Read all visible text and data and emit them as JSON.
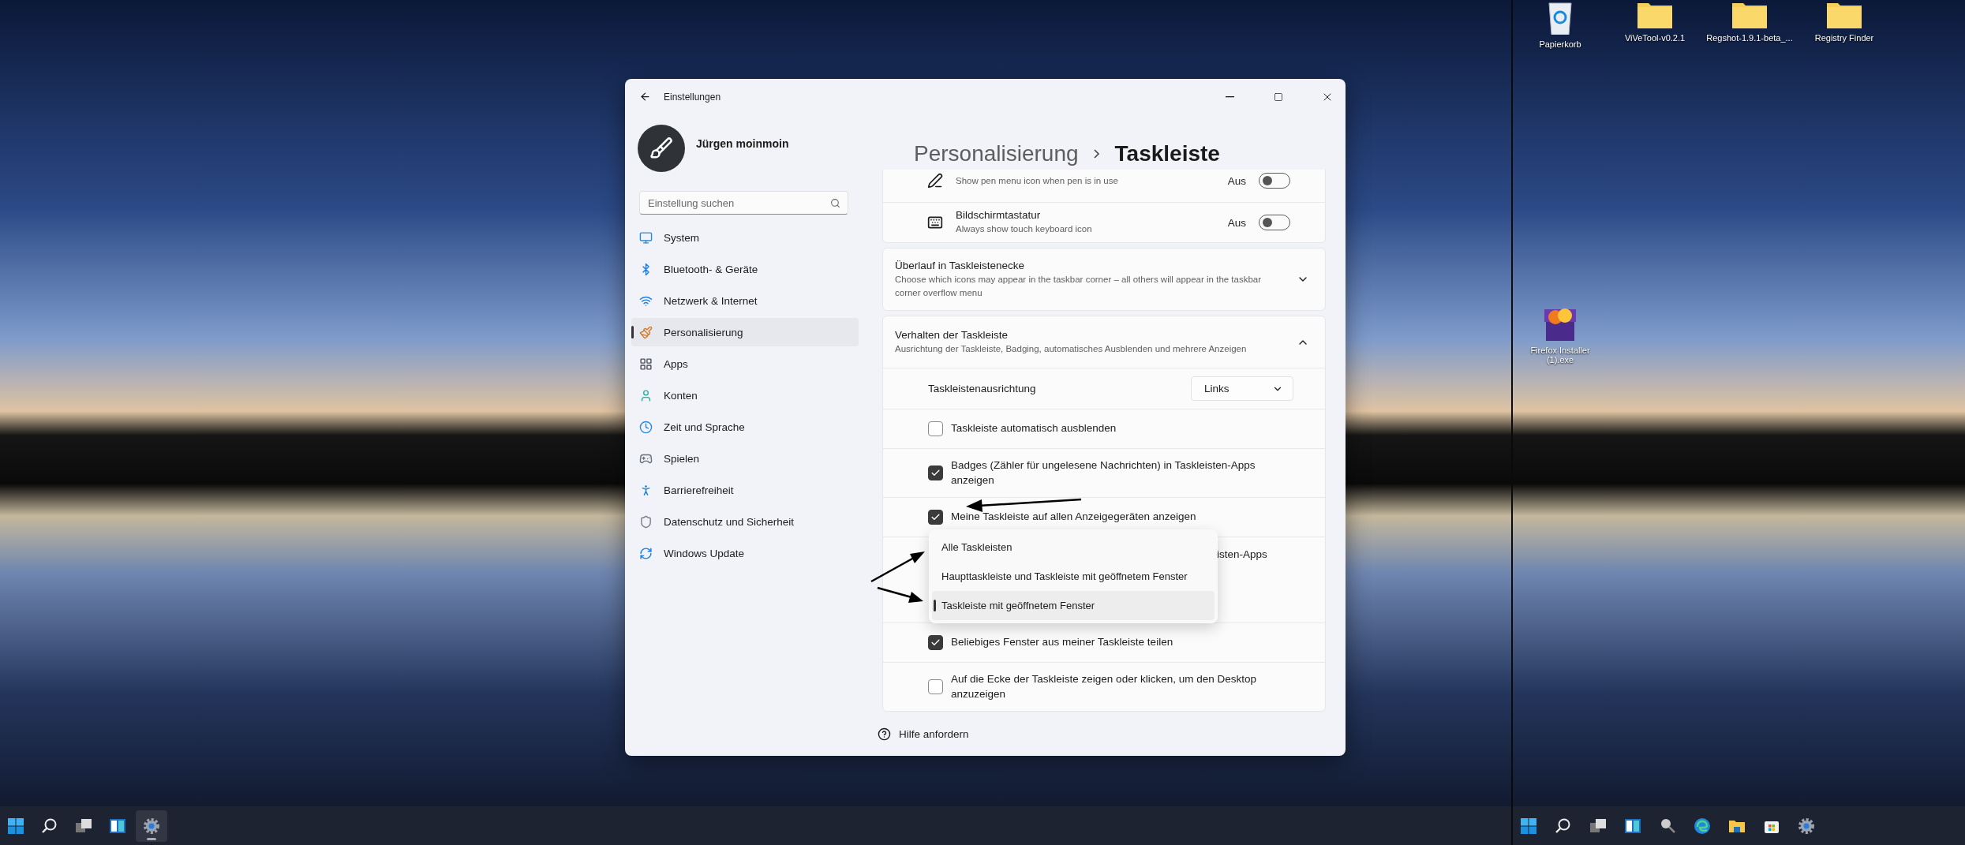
{
  "window": {
    "title": "Einstellungen"
  },
  "profile": {
    "name": "Jürgen moinmoin"
  },
  "search": {
    "placeholder": "Einstellung suchen"
  },
  "nav": [
    {
      "label": "System",
      "selected": false
    },
    {
      "label": "Bluetooth- & Geräte",
      "selected": false
    },
    {
      "label": "Netzwerk & Internet",
      "selected": false
    },
    {
      "label": "Personalisierung",
      "selected": true
    },
    {
      "label": "Apps",
      "selected": false
    },
    {
      "label": "Konten",
      "selected": false
    },
    {
      "label": "Zeit und Sprache",
      "selected": false
    },
    {
      "label": "Spielen",
      "selected": false
    },
    {
      "label": "Barrierefreiheit",
      "selected": false
    },
    {
      "label": "Datenschutz und Sicherheit",
      "selected": false
    },
    {
      "label": "Windows Update",
      "selected": false
    }
  ],
  "breadcrumb": {
    "parent": "Personalisierung",
    "current": "Taskleiste"
  },
  "corner_icons": [
    {
      "kind": "pen",
      "description": "Show pen menu icon when pen is in use",
      "state_label": "Aus",
      "on": false
    },
    {
      "kind": "keyboard",
      "title": "Bildschirmtastatur",
      "description": "Always show touch keyboard icon",
      "state_label": "Aus",
      "on": false
    }
  ],
  "overflow_section": {
    "title": "Überlauf in Taskleistenecke",
    "description": "Choose which icons may appear in the taskbar corner – all others will appear in the taskbar corner overflow menu",
    "expanded": false
  },
  "behavior_section": {
    "title": "Verhalten der Taskleiste",
    "description": "Ausrichtung der Taskleiste, Badging, automatisches Ausblenden und mehrere Anzeigen",
    "expanded": true,
    "alignment": {
      "label": "Taskleistenausrichtung",
      "value": "Links"
    },
    "options": [
      {
        "kind": "checkbox",
        "label": "Taskleiste automatisch ausblenden",
        "checked": false
      },
      {
        "kind": "checkbox",
        "label": "Badges (Zähler für ungelesene Nachrichten) in Taskleisten-Apps anzeigen",
        "checked": true
      },
      {
        "kind": "checkbox",
        "label": "Meine Taskleiste auf allen Anzeigegeräten anzeigen",
        "checked": true
      },
      {
        "kind": "covered",
        "label": "isten-Apps"
      },
      {
        "kind": "checkbox",
        "label": "Beliebiges Fenster aus meiner Taskleiste teilen",
        "checked": true
      },
      {
        "kind": "checkbox",
        "label": "Auf die Ecke der Taskleiste zeigen oder klicken, um den Desktop anzuzeigen",
        "checked": false
      }
    ]
  },
  "dropdown_menu": {
    "items": [
      {
        "label": "Alle Taskleisten",
        "selected": false
      },
      {
        "label": "Haupttaskleiste und Taskleiste mit geöffnetem Fenster",
        "selected": false
      },
      {
        "label": "Taskleiste mit geöffnetem Fenster",
        "selected": true
      }
    ]
  },
  "help_link": "Hilfe anfordern",
  "desktop_icons": [
    {
      "kind": "recycle-bin",
      "label": "Papierkorb"
    },
    {
      "kind": "folder",
      "label": "ViVeTool-v0.2.1"
    },
    {
      "kind": "folder",
      "label": "Regshot-1.9.1-beta_..."
    },
    {
      "kind": "folder",
      "label": "Registry Finder"
    },
    {
      "kind": "installer",
      "label": "Firefox Installer (1).exe"
    }
  ],
  "taskbars": [
    {
      "items": [
        {
          "kind": "start",
          "active": false
        },
        {
          "kind": "search",
          "active": false
        },
        {
          "kind": "task-view",
          "active": false
        },
        {
          "kind": "widgets",
          "active": false
        },
        {
          "kind": "settings",
          "active": true
        }
      ]
    },
    {
      "items": [
        {
          "kind": "start",
          "active": false
        },
        {
          "kind": "search",
          "active": false
        },
        {
          "kind": "task-view",
          "active": false
        },
        {
          "kind": "widgets",
          "active": false
        },
        {
          "kind": "magnifier",
          "active": false
        },
        {
          "kind": "edge",
          "active": false
        },
        {
          "kind": "explorer",
          "active": false
        },
        {
          "kind": "store",
          "active": false
        },
        {
          "kind": "settings",
          "active": false
        }
      ]
    }
  ]
}
